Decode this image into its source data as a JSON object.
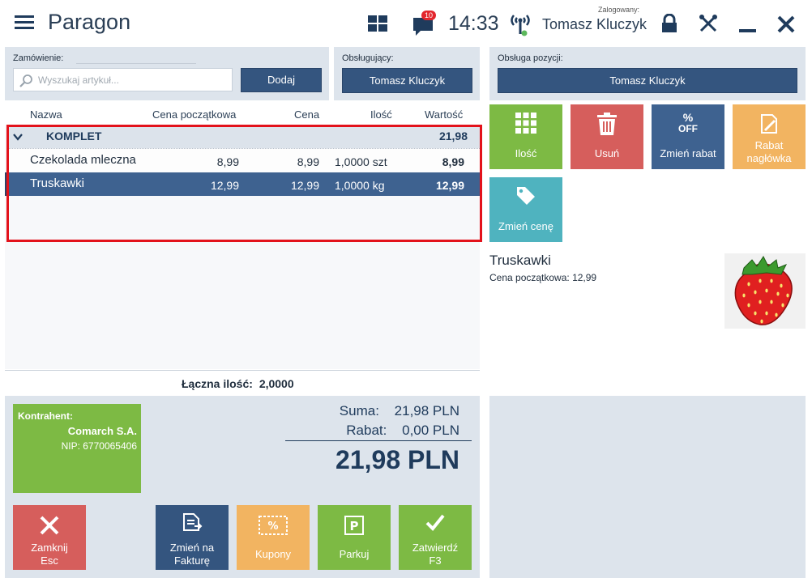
{
  "header": {
    "title": "Paragon",
    "notifications_count": "10",
    "time": "14:33",
    "login_label": "Zalogowany:",
    "user_name": "Tomasz Kluczyk"
  },
  "order": {
    "label": "Zamówienie:",
    "search_placeholder": "Wyszukaj artykuł...",
    "add_label": "Dodaj"
  },
  "serving": {
    "label": "Obsługujący:",
    "value": "Tomasz Kluczyk"
  },
  "position_service": {
    "label": "Obsługa pozycji:",
    "value": "Tomasz Kluczyk"
  },
  "table": {
    "columns": {
      "name": "Nazwa",
      "start_price": "Cena początkowa",
      "price": "Cena",
      "qty": "Ilość",
      "value": "Wartość"
    },
    "group": {
      "name": "KOMPLET",
      "value": "21,98"
    },
    "rows": [
      {
        "name": "Czekolada mleczna",
        "start_price": "8,99",
        "price": "8,99",
        "qty": "1,0000 szt",
        "value": "8,99"
      },
      {
        "name": "Truskawki",
        "start_price": "12,99",
        "price": "12,99",
        "qty": "1,0000 kg",
        "value": "12,99"
      }
    ],
    "total_qty_label": "Łączna ilość:",
    "total_qty": "2,0000"
  },
  "tiles": {
    "qty": "Ilość",
    "delete": "Usuń",
    "change_discount": "Zmień rabat",
    "off_text": "OFF",
    "header_discount_1": "Rabat",
    "header_discount_2": "nagłówka",
    "change_price": "Zmień cenę"
  },
  "item_info": {
    "name": "Truskawki",
    "start_price_label": "Cena początkowa:",
    "start_price": "12,99"
  },
  "contractor": {
    "label": "Kontrahent:",
    "name": "Comarch S.A.",
    "nip": "NIP: 6770065406"
  },
  "summary": {
    "sum_label": "Suma:",
    "sum": "21,98 PLN",
    "discount_label": "Rabat:",
    "discount": "0,00 PLN",
    "total": "21,98 PLN"
  },
  "actions": {
    "close_1": "Zamknij",
    "close_2": "Esc",
    "invoice_1": "Zmień na",
    "invoice_2": "Fakturę",
    "coupons": "Kupony",
    "park": "Parkuj",
    "confirm_1": "Zatwierdź",
    "confirm_2": "F3"
  },
  "colors": {
    "navy": "#34557f",
    "green": "#7dba44",
    "red": "#d9534f",
    "orange": "#f2a94e",
    "teal": "#4fb3bf",
    "highlight": "#e3121b"
  }
}
